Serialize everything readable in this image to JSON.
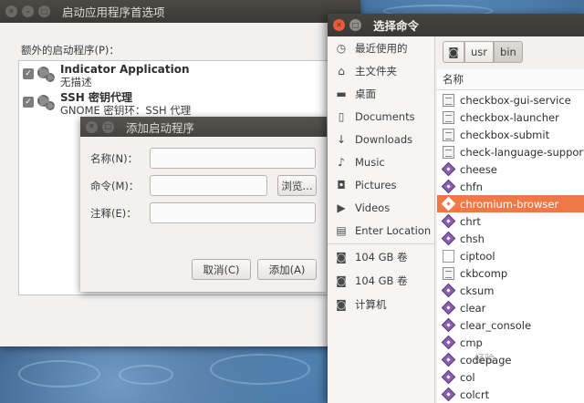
{
  "startup_window": {
    "title": "启动应用程序首选项",
    "section_label": "额外的启动程序(P)：",
    "programs": [
      {
        "name": "Indicator Application",
        "description": "无描述"
      },
      {
        "name": "SSH 密钥代理",
        "description": "GNOME 密钥环：SSH 代理"
      }
    ]
  },
  "add_dialog": {
    "title": "添加启动程序",
    "name_label": "名称(N)：",
    "command_label": "命令(M)：",
    "comment_label": "注释(E)：",
    "browse_button": "浏览...",
    "cancel_button": "取消(C)",
    "add_button": "添加(A)"
  },
  "chooser": {
    "title": "选择命令",
    "sidebar": [
      {
        "label": "最近使用的",
        "icon": "clock-icon"
      },
      {
        "label": "主文件夹",
        "icon": "home-icon"
      },
      {
        "label": "桌面",
        "icon": "folder-icon"
      },
      {
        "label": "Documents",
        "icon": "document-icon"
      },
      {
        "label": "Downloads",
        "icon": "download-icon"
      },
      {
        "label": "Music",
        "icon": "music-icon"
      },
      {
        "label": "Pictures",
        "icon": "camera-icon"
      },
      {
        "label": "Videos",
        "icon": "video-icon"
      },
      {
        "label": "Enter Location",
        "icon": "location-icon"
      },
      {
        "label": "104 GB 卷",
        "icon": "drive-icon"
      },
      {
        "label": "104 GB 卷",
        "icon": "drive-icon"
      },
      {
        "label": "计算机",
        "icon": "drive-icon"
      }
    ],
    "path": [
      "usr",
      "bin"
    ],
    "column_header": "名称",
    "files": [
      {
        "name": "checkbox-gui-service",
        "type": "script"
      },
      {
        "name": "checkbox-launcher",
        "type": "script"
      },
      {
        "name": "checkbox-submit",
        "type": "script"
      },
      {
        "name": "check-language-support",
        "type": "script"
      },
      {
        "name": "cheese",
        "type": "exec"
      },
      {
        "name": "chfn",
        "type": "exec"
      },
      {
        "name": "chromium-browser",
        "type": "exec",
        "selected": true
      },
      {
        "name": "chrt",
        "type": "exec"
      },
      {
        "name": "chsh",
        "type": "exec"
      },
      {
        "name": "ciptool",
        "type": "plain"
      },
      {
        "name": "ckbcomp",
        "type": "script"
      },
      {
        "name": "cksum",
        "type": "exec"
      },
      {
        "name": "clear",
        "type": "exec"
      },
      {
        "name": "clear_console",
        "type": "exec"
      },
      {
        "name": "cmp",
        "type": "exec"
      },
      {
        "name": "codepage",
        "type": "exec"
      },
      {
        "name": "col",
        "type": "exec"
      },
      {
        "name": "colcrt",
        "type": "exec"
      }
    ]
  },
  "watermark": "经验"
}
